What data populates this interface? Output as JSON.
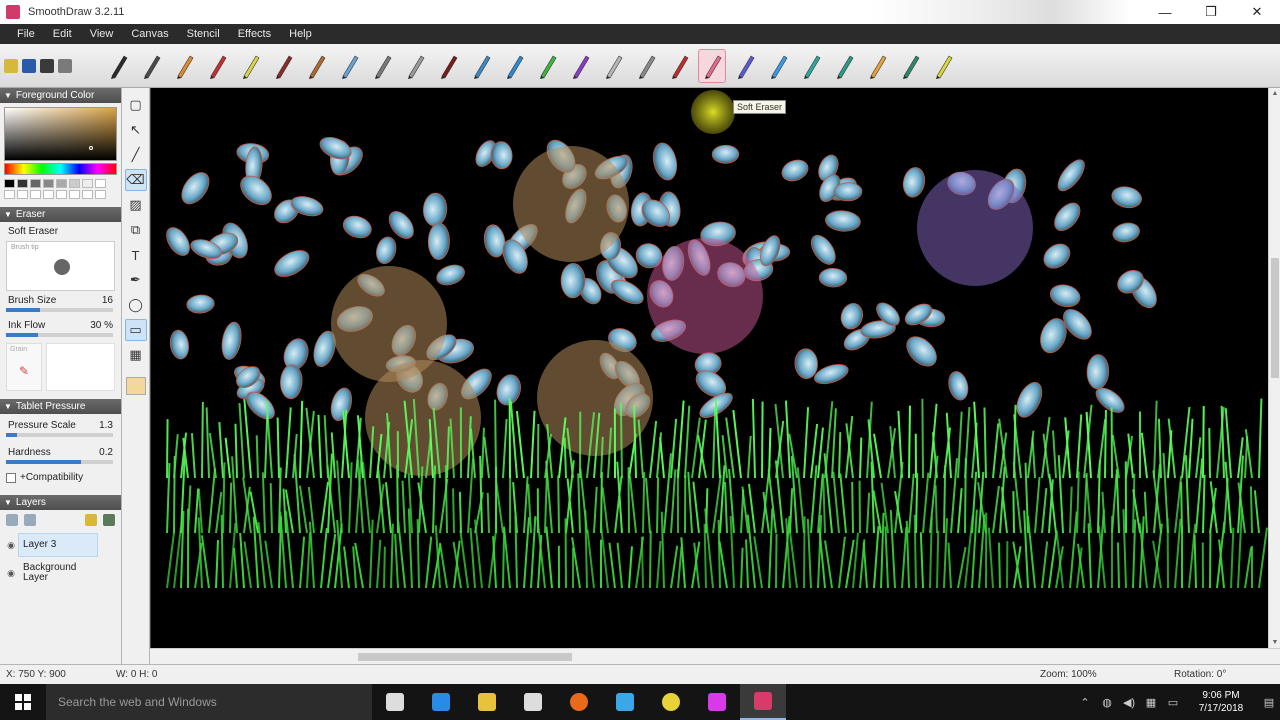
{
  "window": {
    "title": "SmoothDraw 3.2.11",
    "minimize": "—",
    "maximize": "❒",
    "close": "✕"
  },
  "menu": [
    "File",
    "Edit",
    "View",
    "Canvas",
    "Stencil",
    "Effects",
    "Help"
  ],
  "toolbar": {
    "quick_icons": [
      "open-icon",
      "save-icon",
      "undo-icon",
      "redo-icon"
    ],
    "tools": [
      {
        "name": "pen-tool",
        "color": "#2a2a2a"
      },
      {
        "name": "pencil-tool",
        "color": "#4a4a4a"
      },
      {
        "name": "orange-pencil-tool",
        "color": "#e08a2a"
      },
      {
        "name": "red-pencil-tool",
        "color": "#c43030"
      },
      {
        "name": "highlighter-tool",
        "color": "#d6d64a"
      },
      {
        "name": "marker-tool",
        "color": "#8a2a2a"
      },
      {
        "name": "brush-tool",
        "color": "#b06a2a"
      },
      {
        "name": "airbrush-tool",
        "color": "#6aa2d8"
      },
      {
        "name": "airbrush2-tool",
        "color": "#7a7a7a"
      },
      {
        "name": "airbrush3-tool",
        "color": "#9a9a9a"
      },
      {
        "name": "ink-tool",
        "color": "#7a1a1a"
      },
      {
        "name": "watercolor-tool",
        "color": "#3a8ac8"
      },
      {
        "name": "swirl-tool",
        "color": "#2a8ad8"
      },
      {
        "name": "grass-tool",
        "color": "#3ab83a"
      },
      {
        "name": "flowers-tool",
        "color": "#8a3ac8"
      },
      {
        "name": "cloud-tool",
        "color": "#b8b8b8"
      },
      {
        "name": "rock-tool",
        "color": "#8a8a8a"
      },
      {
        "name": "stamp-tool",
        "color": "#c42a2a"
      },
      {
        "name": "soft-eraser-tool",
        "color": "#e86a8a"
      },
      {
        "name": "hard-eraser-tool",
        "color": "#5a5ad8"
      },
      {
        "name": "drop-tool",
        "color": "#3a9ae8"
      },
      {
        "name": "smudge-tool",
        "color": "#2aa89a"
      },
      {
        "name": "blur-tool",
        "color": "#2a9a8a"
      },
      {
        "name": "leaf-tool",
        "color": "#e8a23a"
      },
      {
        "name": "fill-tool",
        "color": "#2a8a6a"
      },
      {
        "name": "stencil-tool",
        "color": "#d8d83a"
      }
    ],
    "active_index": 18
  },
  "tooltip": "Soft Eraser",
  "panels": {
    "foreground": {
      "title": "Foreground Color"
    },
    "eraser": {
      "title": "Eraser",
      "preset": "Soft Eraser",
      "preview_label": "Brush tip",
      "brush_size_label": "Brush Size",
      "brush_size": "16",
      "ink_flow_label": "Ink Flow",
      "ink_flow": "30 %",
      "brush_size_fraction": 0.32,
      "ink_flow_fraction": 0.3,
      "paper_label": "Grain"
    },
    "tablet": {
      "title": "Tablet Pressure",
      "pressure_scale_label": "Pressure Scale",
      "pressure_scale": "1.3",
      "pressure_scale_fraction": 0.1,
      "hardness_label": "Hardness",
      "hardness": "0.2",
      "hardness_fraction": 0.7,
      "compat_label": "+Compatibility"
    },
    "layers": {
      "title": "Layers",
      "items": [
        "Layer 3",
        "Background Layer"
      ]
    }
  },
  "vtools": [
    "select-rect-icon",
    "move-icon",
    "brush-icon",
    "eraser-icon",
    "bucket-icon",
    "clone-icon",
    "text-icon",
    "picker-icon",
    "lasso-icon",
    "rectangle-icon",
    "gradient-icon"
  ],
  "status": {
    "coords": "X: 750 Y: 900",
    "size": "W: 0 H: 0",
    "zoom": "Zoom: 100%",
    "rotation": "Rotation: 0°"
  },
  "taskbar": {
    "search_placeholder": "Search the web and Windows",
    "apps": [
      "task-view-icon",
      "edge-icon",
      "file-explorer-icon",
      "store-icon",
      "firefox-icon",
      "paint-icon",
      "chrome-icon",
      "media-icon",
      "smoothdraw-icon"
    ],
    "time": "9:06 PM",
    "date": "7/17/2018"
  },
  "colors": {
    "accent": "#3a7ac8",
    "grass": "#3aff3a",
    "wing": "#7ab8d8"
  }
}
